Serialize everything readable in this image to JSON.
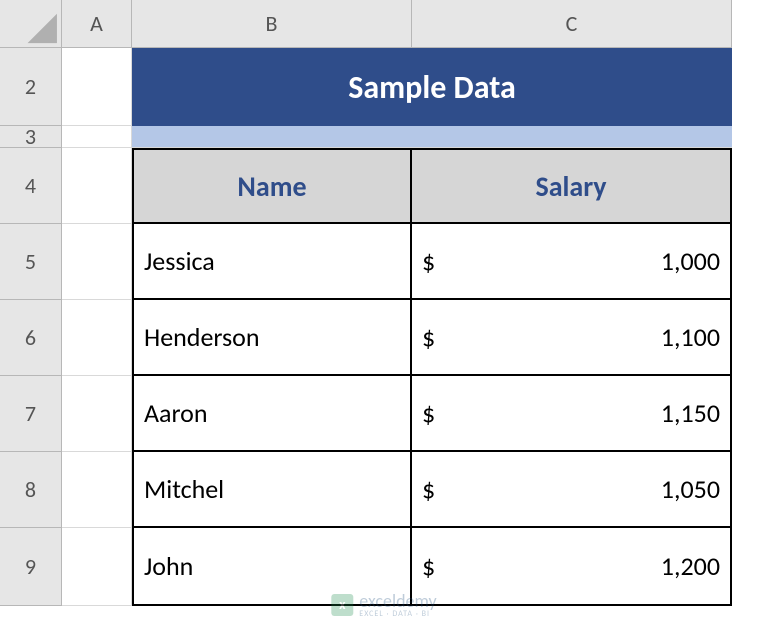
{
  "columns": {
    "A": "A",
    "B": "B",
    "C": "C"
  },
  "rows": {
    "r2": "2",
    "r3": "3",
    "r4": "4",
    "r5": "5",
    "r6": "6",
    "r7": "7",
    "r8": "8",
    "r9": "9"
  },
  "title": "Sample Data",
  "headers": {
    "name": "Name",
    "salary": "Salary"
  },
  "currency": "$",
  "data": [
    {
      "name": "Jessica",
      "salary": "1,000"
    },
    {
      "name": "Henderson",
      "salary": "1,100"
    },
    {
      "name": "Aaron",
      "salary": "1,150"
    },
    {
      "name": "Mitchel",
      "salary": "1,050"
    },
    {
      "name": "John",
      "salary": "1,200"
    }
  ],
  "watermark": {
    "brand": "exceldemy",
    "tagline": "EXCEL · DATA · BI"
  },
  "chart_data": {
    "type": "table",
    "title": "Sample Data",
    "columns": [
      "Name",
      "Salary"
    ],
    "rows": [
      [
        "Jessica",
        1000
      ],
      [
        "Henderson",
        1100
      ],
      [
        "Aaron",
        1150
      ],
      [
        "Mitchel",
        1050
      ],
      [
        "John",
        1200
      ]
    ],
    "currency": "$"
  }
}
